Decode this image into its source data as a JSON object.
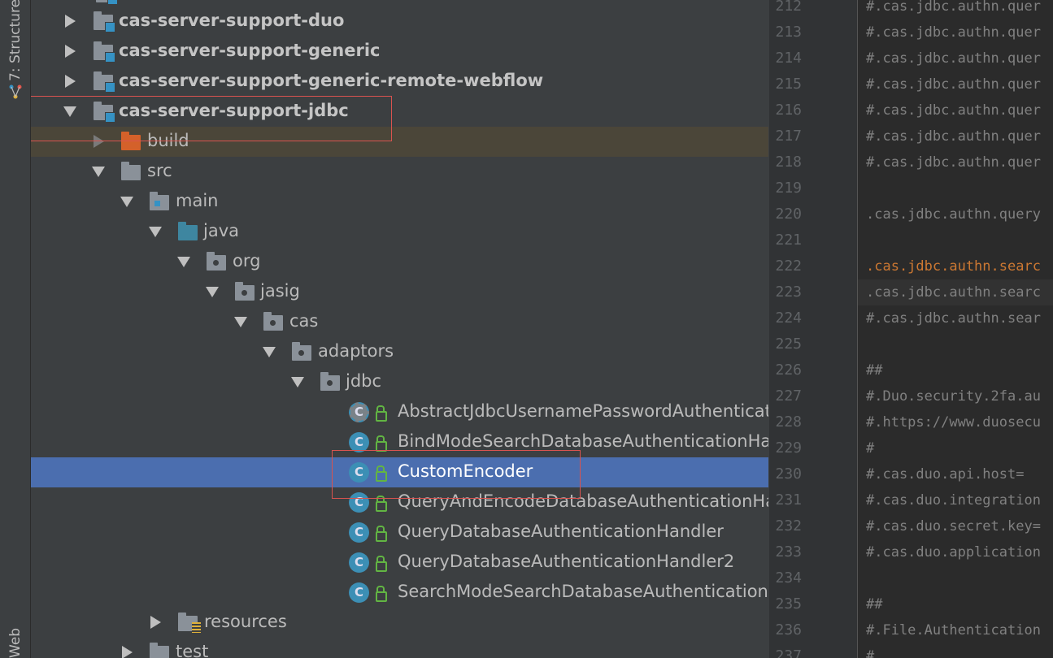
{
  "side_strip": {
    "structure_label": "7: Structure",
    "web_label": "Web"
  },
  "tree": {
    "rows": [
      {
        "label": "cas-server-support-duo"
      },
      {
        "label": "cas-server-support-generic"
      },
      {
        "label": "cas-server-support-generic-remote-webflow"
      },
      {
        "label": "cas-server-support-jdbc"
      },
      {
        "label": "build"
      },
      {
        "label": "src"
      },
      {
        "label": "main"
      },
      {
        "label": "java"
      },
      {
        "label": "org"
      },
      {
        "label": "jasig"
      },
      {
        "label": "cas"
      },
      {
        "label": "adaptors"
      },
      {
        "label": "jdbc"
      },
      {
        "label": "AbstractJdbcUsernamePasswordAuthenticat",
        "icon": "C"
      },
      {
        "label": "BindModeSearchDatabaseAuthenticationHa",
        "icon": "C"
      },
      {
        "label": "CustomEncoder",
        "icon": "C"
      },
      {
        "label": "QueryAndEncodeDatabaseAuthenticationHa",
        "icon": "C"
      },
      {
        "label": "QueryDatabaseAuthenticationHandler",
        "icon": "C"
      },
      {
        "label": "QueryDatabaseAuthenticationHandler2",
        "icon": "C"
      },
      {
        "label": "SearchModeSearchDatabaseAuthentication",
        "icon": "C"
      },
      {
        "label": "resources"
      },
      {
        "label": "test"
      }
    ]
  },
  "editor": {
    "lines": [
      {
        "num": "212",
        "text": "#.cas.jdbc.authn.quer"
      },
      {
        "num": "213",
        "text": "#.cas.jdbc.authn.quer"
      },
      {
        "num": "214",
        "text": "#.cas.jdbc.authn.quer"
      },
      {
        "num": "215",
        "text": "#.cas.jdbc.authn.quer"
      },
      {
        "num": "216",
        "text": "#.cas.jdbc.authn.quer"
      },
      {
        "num": "217",
        "text": "#.cas.jdbc.authn.quer"
      },
      {
        "num": "218",
        "text": "#.cas.jdbc.authn.quer"
      },
      {
        "num": "219",
        "text": ""
      },
      {
        "num": "220",
        "text": ".cas.jdbc.authn.query"
      },
      {
        "num": "221",
        "text": ""
      },
      {
        "num": "222",
        "text": ".cas.jdbc.authn.searc"
      },
      {
        "num": "223",
        "text": ".cas.jdbc.authn.searc"
      },
      {
        "num": "224",
        "text": "#.cas.jdbc.authn.sear"
      },
      {
        "num": "225",
        "text": ""
      },
      {
        "num": "226",
        "text": "##"
      },
      {
        "num": "227",
        "text": "#.Duo.security.2fa.au"
      },
      {
        "num": "228",
        "text": "#.https://www.duosecu"
      },
      {
        "num": "229",
        "text": "#"
      },
      {
        "num": "230",
        "text": "#.cas.duo.api.host="
      },
      {
        "num": "231",
        "text": "#.cas.duo.integration"
      },
      {
        "num": "232",
        "text": "#.cas.duo.secret.key="
      },
      {
        "num": "233",
        "text": "#.cas.duo.application"
      },
      {
        "num": "234",
        "text": ""
      },
      {
        "num": "235",
        "text": "##"
      },
      {
        "num": "236",
        "text": "#.File.Authentication"
      },
      {
        "num": "237",
        "text": "#"
      }
    ]
  }
}
